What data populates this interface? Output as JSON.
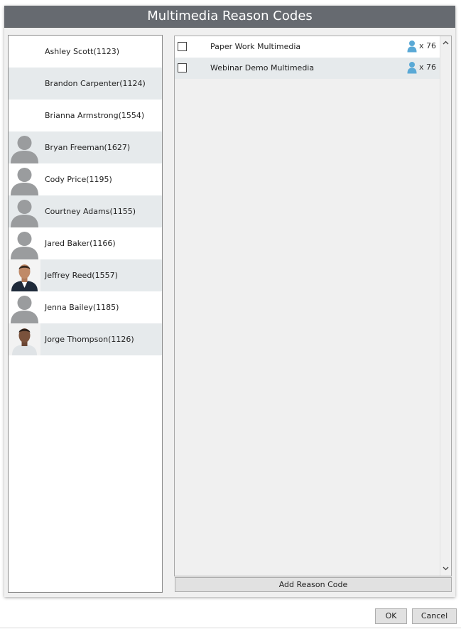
{
  "dialog": {
    "title": "Multimedia Reason Codes"
  },
  "agents": [
    {
      "name": "Ashley Scott(1123)",
      "avatar": "none"
    },
    {
      "name": "Brandon Carpenter(1124)",
      "avatar": "none"
    },
    {
      "name": "Brianna Armstrong(1554)",
      "avatar": "none"
    },
    {
      "name": "Bryan Freeman(1627)",
      "avatar": "silhouette"
    },
    {
      "name": "Cody Price(1195)",
      "avatar": "silhouette"
    },
    {
      "name": "Courtney Adams(1155)",
      "avatar": "silhouette"
    },
    {
      "name": "Jared Baker(1166)",
      "avatar": "silhouette"
    },
    {
      "name": "Jeffrey Reed(1557)",
      "avatar": "photo"
    },
    {
      "name": "Jenna Bailey(1185)",
      "avatar": "silhouette"
    },
    {
      "name": "Jorge Thompson(1126)",
      "avatar": "photo"
    }
  ],
  "reason_codes": [
    {
      "name": "Paper Work Multimedia",
      "count": "x 76",
      "checked": false
    },
    {
      "name": "Webinar Demo Multimedia",
      "count": "x 76",
      "checked": false
    }
  ],
  "buttons": {
    "add_reason_code": "Add Reason Code",
    "ok": "OK",
    "cancel": "Cancel"
  },
  "icons": {
    "user": "user-icon",
    "scroll_up": "chevron-up-icon",
    "scroll_down": "chevron-down-icon"
  },
  "colors": {
    "titlebar": "#666a70",
    "row_alt": "#e6eaec",
    "user_icon": "#5aa9d6"
  }
}
